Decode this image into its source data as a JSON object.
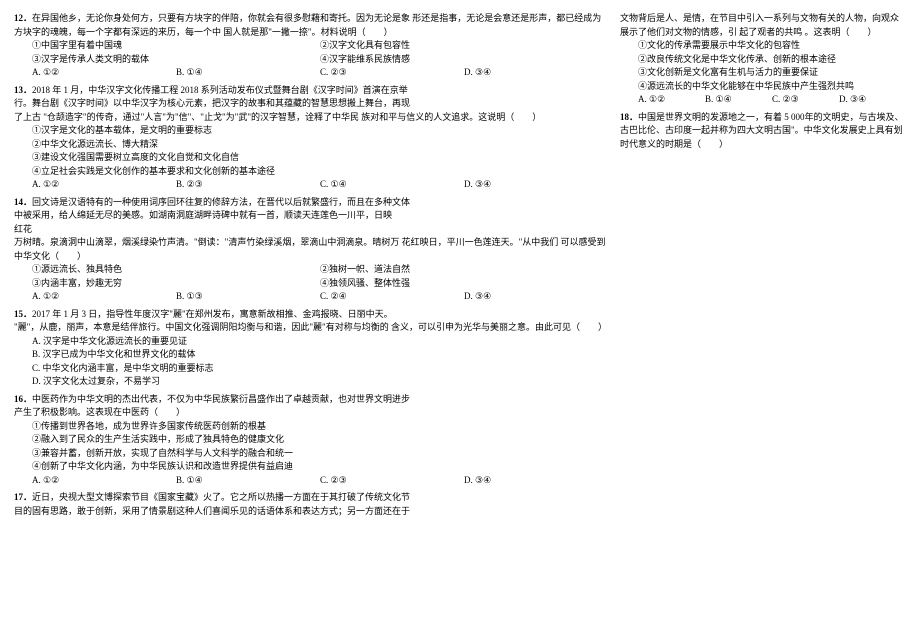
{
  "left": {
    "q12": {
      "num": "12．",
      "text": "在异国他乡，无论你身处何方，只要有方块字的伴陪，你就会有很多慰藉和寄托。因为无论是象 形还是指事，无论是会意还是形声，都已经成为方块字的魂魄，每一个字都有深远的来历，每一个中 国人就是那\"一撇一捺\"。材料说明（　　）",
      "opts": [
        "①中国字里有着中国魂",
        "②汉字文化具有包容性",
        "③汉字是传承人类文明的载体",
        "④汉字能维系民族情感"
      ],
      "choices": [
        "A. ①②",
        "B. ①④",
        "C. ②③",
        "D. ③④"
      ]
    },
    "q13": {
      "num": "13．",
      "text1": "2018 年 1 月，中华汉字文化传播工程 2018 系列活动发布仪式暨舞台剧《汉字时间》首演在京举",
      "text2": "行。舞台剧《汉字时间》以中华汉字为核心元素，把汉字的故事和其蕴藏的智慧思想搬上舞台，再现",
      "text3": "了上古 \"仓颉造字\"的传奇，通过\"人言\"为\"信\"、\"止戈\"为\"武\"的汉字智慧，诠释了中华民 族对和平与信义的人文追求。这说明（　　）",
      "opts": [
        "①汉字是文化的基本载体，是文明的重要标志",
        "②中华文化源远流长、博大精深",
        "③建设文化强国需要树立高度的文化自觉和文化自信",
        "④立足社会实践是文化创作的基本要求和文化创新的基本途径"
      ],
      "choices": [
        "A. ①②",
        "B. ②③",
        "C. ①④",
        "D. ③④"
      ]
    },
    "q14": {
      "num": "14．",
      "text1": "回文诗是汉语特有的一种使用词序回环往复的修辞方法，在晋代以后就繁盛行，而且在多种文体",
      "text2": "中被采用，给人绵延无尽的美感。如湖南洞庭湖畔诗碑中就有一首，顺读天连莲色一川平，日映",
      "text3": "红花",
      "text4": "万树晴。泉滴洞中山滴翠，烟溪绿染竹声清。\"倒读：\"清声竹染绿溪烟，翠滴山中洞滴泉。晴树万 花红映日，平川一色莲连天。\"从中我们 可以感受到中华文化（　　）",
      "opts": [
        "①源远流长、独具特色",
        "②独树一帜、道法自然",
        "③内涵丰富，妙趣无穷",
        "④独领风骚、整体性强"
      ],
      "choices": [
        "A. ①②",
        "B. ①③",
        "C. ②④",
        "D. ③④"
      ]
    },
    "q15": {
      "num": "15．",
      "text1": "2017 年 1 月 3 日，指导性年度汉字\"麗\"在郑州发布，寓意新故相推、金鸡报晓、日丽中天。",
      "text2": "\"麗\"，从鹿，丽声，本意是结伴旅行。中国文化强调阴阳均衡与和谐，因此\"麗\"有对称与均衡的 含义，可以引申为光华与美丽之意。由此可见（　　）",
      "opts": [
        "A. 汉字是中华文化源远流长的重要见证",
        "B. 汉字已成为中华文化和世界文化的载体",
        "C. 中华文化内涵丰富，是中华文明的重要标志",
        "D. 汉字文化太过复杂，不易学习"
      ]
    },
    "q16": {
      "num": "16．",
      "text1": "中医药作为中华文明的杰出代表，不仅为中华民族繁衍昌盛作出了卓越贡献，也对世界文明进步",
      "text2": "产生了积极影响。这表现在中医药（　　）",
      "opts": [
        "①传播到世界各地，成为世界许多国家传统医药创新的根基",
        "②融入到了民众的生产生活实践中，形成了独具特色的健康文化",
        "③兼容并蓄，创新开放，实现了自然科学与人文科学的融合和统一",
        "④创新了中华文化内涵，为中华民族认识和改造世界提供有益启迪"
      ],
      "choices": [
        "A. ①②",
        "B. ①④",
        "C. ②③",
        "D. ③④"
      ]
    },
    "q17": {
      "num": "17．",
      "text1": "近日，央视大型文博探索节目《国家宝藏》火了。它之所以热播一方面在于其打破了传统文化节",
      "text2": "目的固有思路，敢于创新，采用了情景剧这种人们喜闻乐见的话语体系和表达方式；另一方面还在于"
    }
  },
  "right": {
    "q17cont": {
      "text": "文物背后是人、是情，在节目中引入一系列与文物有关的人物，向观众展示了他们对文物的情感，引 起了观者的共鸣 。这表明（　　）",
      "opts": [
        "①文化的传承需要展示中华文化的包容性",
        "②改良传统文化是中华文化传承、创新的根本途径",
        "③文化创新是文化富有生机与活力的重要保证",
        "④源远流长的中华文化能够在中华民族中产生强烈共鸣"
      ],
      "choices": [
        "A. ①②",
        "B. ①④",
        "C. ②③",
        "D. ③④"
      ]
    },
    "q18": {
      "num": "18．",
      "text": "中国是世界文明的发源地之一，有着 5 000年的文明史，与古埃及、古巴比伦、古印度一起并称为四大文明古国\"。中华文化发展史上具有划时代意义的时期是（　　）"
    }
  }
}
